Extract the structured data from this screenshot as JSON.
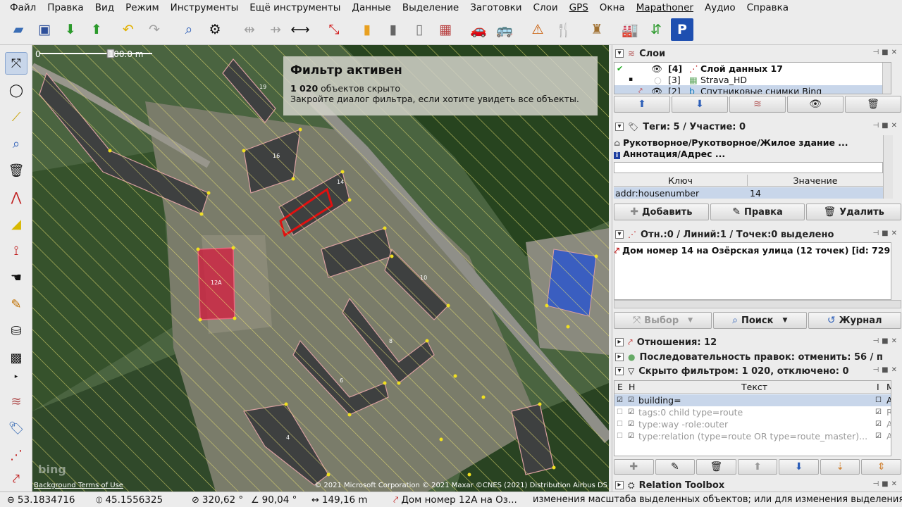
{
  "menu": [
    "Файл",
    "Правка",
    "Вид",
    "Режим",
    "Инструменты",
    "Ещё инструменты",
    "Данные",
    "Выделение",
    "Заготовки",
    "Слои",
    "GPS",
    "Окна",
    "Mapathoner",
    "Аудио",
    "Справка"
  ],
  "map": {
    "filter_title": "Фильтр активен",
    "filter_count": "1 020",
    "filter_line1_rest": " объектов скрыто",
    "filter_line2": "Закройте диалог фильтра, если хотите увидеть все объекты.",
    "scale_zero": "0",
    "scale_label": "100.0 m",
    "copyright": "© 2021 Microsoft Corporation © 2021 Maxar ©CNES (2021) Distribution Airbus DS",
    "bg_terms": "Background Terms of Use",
    "bing": "bing",
    "building_labels": [
      "19",
      "16",
      "14",
      "12A",
      "10",
      "8",
      "6",
      "4"
    ]
  },
  "layers": {
    "title": "Слои",
    "items": [
      {
        "index": "[4]",
        "name": "Слой данных 17"
      },
      {
        "index": "[3]",
        "name": "Strava_HD"
      },
      {
        "index": "[2]",
        "name": "Спутниковые снимки Bing"
      }
    ]
  },
  "tags": {
    "title": "Теги: 5 / Участие: 0",
    "presets": [
      "Рукотворное/Рукотворное/Жилое здание ...",
      "Аннотация/Адрес ..."
    ],
    "col_key": "Ключ",
    "col_value": "Значение",
    "rows": [
      {
        "key": "addr:housenumber",
        "value": "14"
      }
    ],
    "add": "Добавить",
    "edit": "Правка",
    "delete": "Удалить"
  },
  "selection": {
    "title": "Отн.:0 / Линий:1 / Точек:0 выделено",
    "item": "Дом номер 14 на Озёрская улица (12 точек) [id: 729",
    "select_btn": "Выбор",
    "search_btn": "Поиск",
    "history_btn": "Журнал"
  },
  "relations": {
    "title": "Отношения: 12"
  },
  "changesets": {
    "title": "Последовательность правок: отменить: 56 / п"
  },
  "filter": {
    "title": "Скрыто фильтром: 1 020, отключено: 0",
    "col_e": "E",
    "col_h": "H",
    "col_text": "Текст",
    "col_i": "I",
    "col_m": "M",
    "rows": [
      {
        "text": "building=",
        "m": "A",
        "active": true
      },
      {
        "text": "tags:0 child type=route",
        "m": "R",
        "active": false
      },
      {
        "text": "type:way -role:outer",
        "m": "A",
        "active": false
      },
      {
        "text": "type:relation (type=route OR type=route_master)...",
        "m": "A",
        "active": false
      }
    ]
  },
  "relation_toolbox": {
    "title": "Relation Toolbox"
  },
  "status": {
    "lat": "53.1834716",
    "lon": "45.1556325",
    "heading": "320,62 °",
    "angle": "90,04 °",
    "distance": "149,16 m",
    "object": "Дом номер 12A на Оз...",
    "message": "изменения масштаба выделенных объектов; или для изменения выделения"
  },
  "colors": {
    "accent": "#3c6bc4",
    "selection_red": "#e01010",
    "node_yellow": "#f0e020"
  }
}
